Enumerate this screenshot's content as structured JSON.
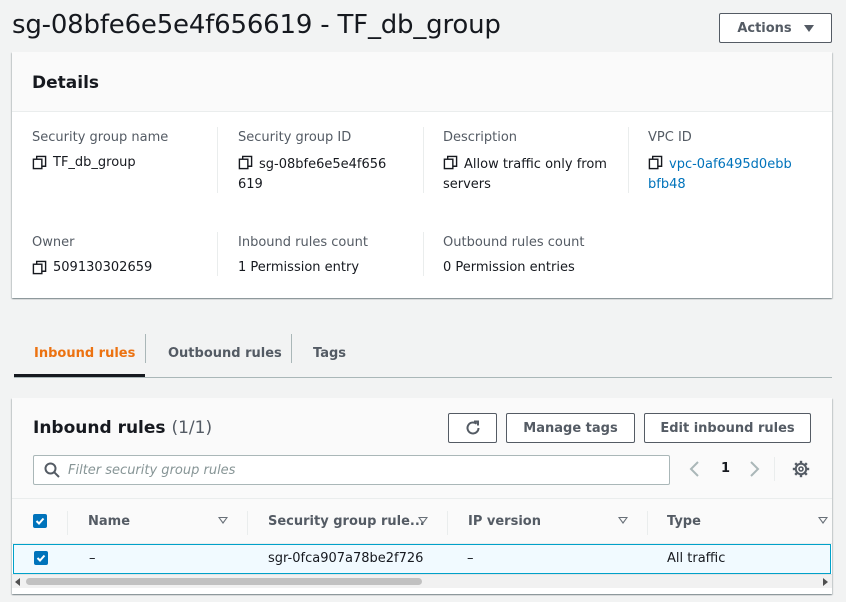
{
  "header": {
    "title": "sg-08bfe6e5e4f656619 - TF_db_group",
    "actions_label": "Actions"
  },
  "details": {
    "title": "Details",
    "fields": {
      "sg_name": {
        "label": "Security group name",
        "value": "TF_db_group"
      },
      "sg_id": {
        "label": "Security group ID",
        "value": "sg-08bfe6e5e4f656619"
      },
      "description": {
        "label": "Description",
        "value": "Allow traffic only from servers"
      },
      "vpc_id": {
        "label": "VPC ID",
        "value": "vpc-0af6495d0ebbbfb48"
      },
      "owner": {
        "label": "Owner",
        "value": "509130302659"
      },
      "inbound_count": {
        "label": "Inbound rules count",
        "value": "1 Permission entry"
      },
      "outbound_count": {
        "label": "Outbound rules count",
        "value": "0 Permission entries"
      }
    }
  },
  "tabs": [
    {
      "label": "Inbound rules",
      "active": true
    },
    {
      "label": "Outbound rules",
      "active": false
    },
    {
      "label": "Tags",
      "active": false
    }
  ],
  "inbound": {
    "title": "Inbound rules",
    "count": "(1/1)",
    "manage_tags_label": "Manage tags",
    "edit_label": "Edit inbound rules",
    "search_placeholder": "Filter security group rules",
    "page": "1",
    "columns": [
      "Name",
      "Security group rule...",
      "IP version",
      "Type"
    ],
    "rows": [
      {
        "name": "–",
        "rule_id": "sgr-0fca907a78be2f726",
        "ip_version": "–",
        "type": "All traffic",
        "selected": true
      }
    ]
  },
  "colors": {
    "accent_orange": "#ec7211",
    "link_blue": "#0073bb",
    "selected_border": "#00a1c9"
  },
  "icons": [
    "copy-icon",
    "refresh-icon",
    "search-icon",
    "chevron-left-icon",
    "chevron-right-icon",
    "gear-icon",
    "sort-icon",
    "caret-down-icon",
    "checkbox-checked-icon"
  ]
}
